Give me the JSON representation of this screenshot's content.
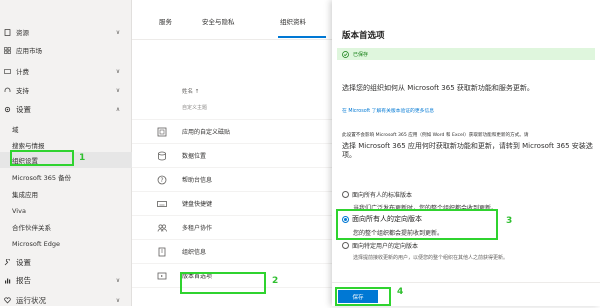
{
  "nav": {
    "items": [
      {
        "label": "资源",
        "icon": "document-icon",
        "chevron": "∨"
      },
      {
        "label": "应用市场",
        "icon": "grid-icon",
        "chevron": ""
      },
      {
        "label": "计费",
        "icon": "card-icon",
        "chevron": "∨"
      },
      {
        "label": "支持",
        "icon": "headset-icon",
        "chevron": "∨"
      },
      {
        "label": "设置",
        "icon": "gear-icon",
        "chevron": "∧"
      },
      {
        "label": "域",
        "icon": "",
        "chevron": ""
      },
      {
        "label": "搜索与情报",
        "icon": "",
        "chevron": ""
      },
      {
        "label": "组织设置",
        "icon": "",
        "chevron": ""
      },
      {
        "label": "Microsoft 365 备份",
        "icon": "",
        "chevron": ""
      },
      {
        "label": "集成应用",
        "icon": "",
        "chevron": ""
      },
      {
        "label": "Viva",
        "icon": "",
        "chevron": ""
      },
      {
        "label": "合作伙伴关系",
        "icon": "",
        "chevron": ""
      },
      {
        "label": "Microsoft Edge",
        "icon": "",
        "chevron": ""
      },
      {
        "label": "设置",
        "icon": "wrench-icon",
        "chevron": ""
      },
      {
        "label": "报告",
        "icon": "chart-icon",
        "chevron": "∨"
      },
      {
        "label": "运行状况",
        "icon": "heart-icon",
        "chevron": "∨"
      }
    ]
  },
  "tabs": [
    {
      "label": "服务"
    },
    {
      "label": "安全与隐私"
    },
    {
      "label": "组织资料"
    }
  ],
  "list": {
    "header": "姓名 ↑",
    "rows": [
      {
        "label": "自定义主题",
        "icon": "palette-icon"
      },
      {
        "label": "应用的自定义磁贴",
        "icon": "tile-icon"
      },
      {
        "label": "数据位置",
        "icon": "database-icon"
      },
      {
        "label": "帮助台信息",
        "icon": "help-icon"
      },
      {
        "label": "键盘快捷键",
        "icon": "keyboard-icon"
      },
      {
        "label": "多租户协作",
        "icon": "people-icon"
      },
      {
        "label": "组织信息",
        "icon": "building-icon"
      },
      {
        "label": "版本首选项",
        "icon": "release-icon"
      }
    ]
  },
  "panel": {
    "title": "版本首选项",
    "saved_text": "已保存",
    "description": "选择您的组织如何从 Microsoft 365 获取新功能和服务更新。",
    "link": "在 Microsoft 了解有关版本验证的更多信息",
    "info_small": "此设置不会影响 Microsoft 365 应用（例如 Word 和 Excel）获取新功能和更新的方式。请",
    "info": "选择 Microsoft 365 应用何时获取新功能和更新，请转到 Microsoft 365 安装选项。",
    "options": [
      {
        "label": "面向所有人的标准版本",
        "desc": "当我们广泛发布更新时，您的整个组织都会收到更新。",
        "selected": false
      },
      {
        "label": "面向所有人的定向版本",
        "desc": "您的整个组织都会提前收到更新。",
        "selected": true
      },
      {
        "label": "面向特定用户的定向版本",
        "desc": "选择提前接收更新的用户，以便您的整个组织在其他人之前获得更新。",
        "selected": false
      }
    ],
    "save_label": "保存"
  },
  "annotations": {
    "step1": "1",
    "step2": "2",
    "step3": "3",
    "step4": "4"
  },
  "colors": {
    "accent": "#0078d4",
    "annotation": "#2fd32f",
    "saved_bg": "#dff6dd"
  }
}
